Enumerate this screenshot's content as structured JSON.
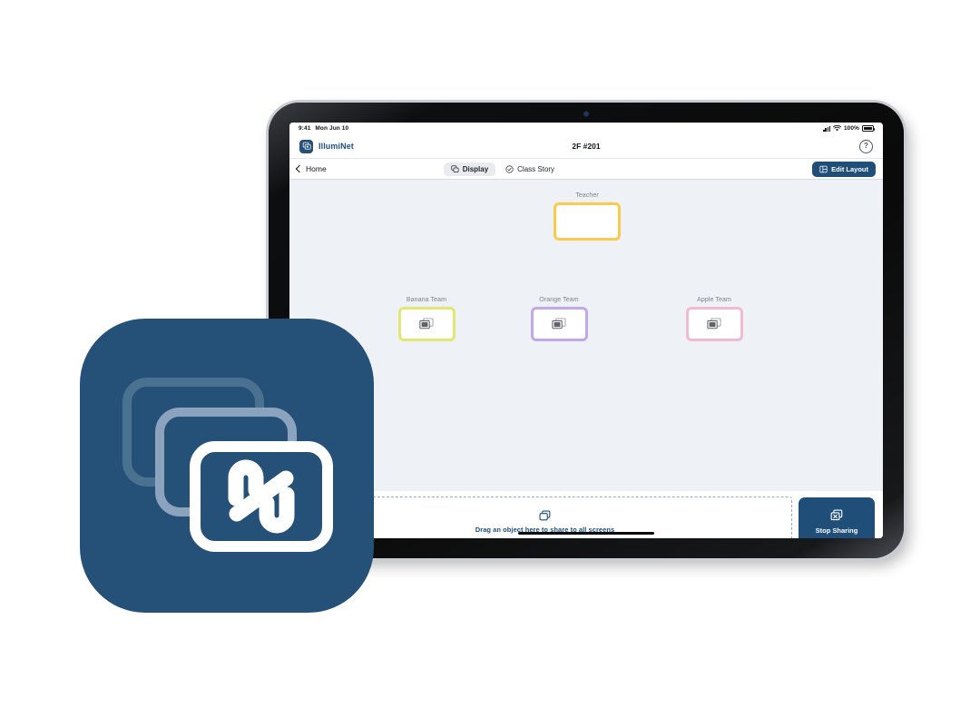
{
  "brand": {
    "name": "IllumiNet",
    "badge_icon": "stacked-screens-icon",
    "primary_color": "#1f4e79",
    "icon_bg_color": "#255077"
  },
  "status_bar": {
    "time": "9:41",
    "date": "Mon Jun 10",
    "signal_icon": "cellular-signal-icon",
    "wifi_icon": "wifi-icon",
    "battery_percent": "100%",
    "battery_icon": "battery-full-icon"
  },
  "app_header": {
    "room_title": "2F #201",
    "help_label": "?",
    "help_icon": "question-mark-circle-icon"
  },
  "nav": {
    "back_label": "Home",
    "back_icon": "chevron-left-icon",
    "tabs": [
      {
        "label": "Display",
        "icon": "stacked-screens-icon",
        "active": true
      },
      {
        "label": "Class Story",
        "icon": "check-circle-icon",
        "active": false
      }
    ],
    "edit_layout_label": "Edit Layout",
    "edit_layout_icon": "layout-grid-icon"
  },
  "stage": {
    "screens": [
      {
        "label": "Teacher",
        "border_color": "#fbc94c",
        "has_cast_icon": false
      },
      {
        "label": "Banana Team",
        "border_color": "#e3e772",
        "has_cast_icon": true
      },
      {
        "label": "Orange Team",
        "border_color": "#c3a7e8",
        "has_cast_icon": true
      },
      {
        "label": "Apple Team",
        "border_color": "#f3b9cf",
        "has_cast_icon": true
      }
    ],
    "cast_icon": "screen-share-icon",
    "background_color": "#eef1f6"
  },
  "share_bar": {
    "dropzone_label": "Drag an object here to share to all screens",
    "dropzone_icon": "stacked-screens-icon",
    "stop_label": "Stop Sharing",
    "stop_icon": "stop-share-icon"
  },
  "app_icon": {
    "name": "illuminet-app-icon",
    "glyph": "interlocking-n-logo-icon"
  }
}
